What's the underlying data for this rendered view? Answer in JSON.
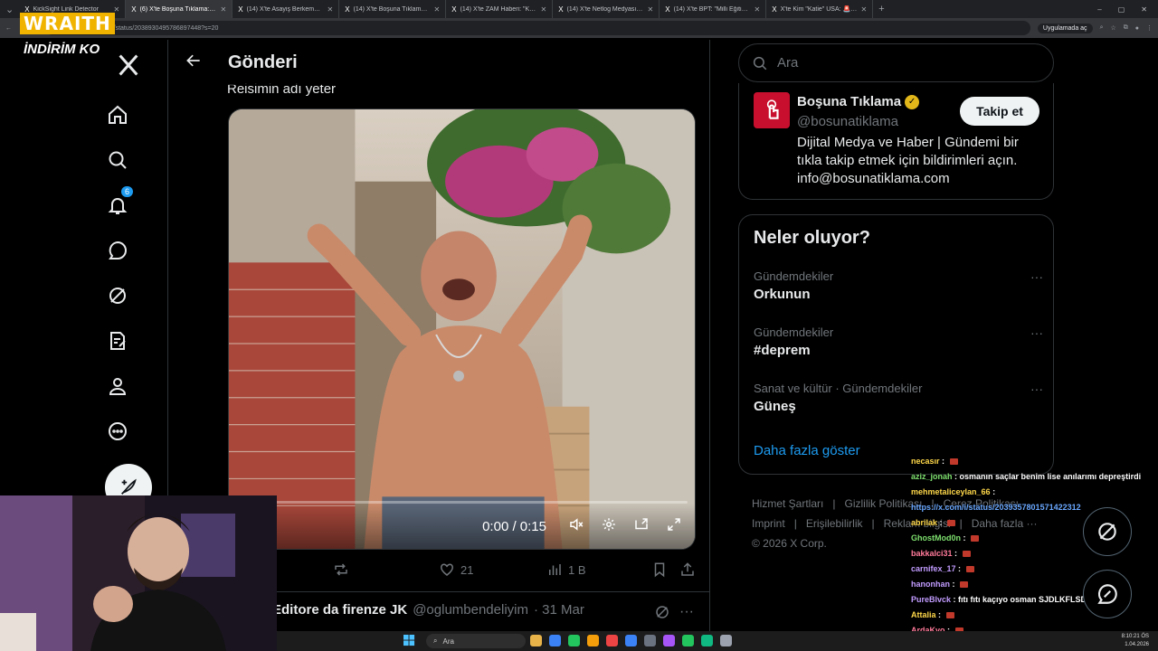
{
  "browser": {
    "tabs": [
      {
        "title": "KickSight Link Detector",
        "active": false
      },
      {
        "title": "(6) X'te Boşuna Tıklama: \"En...",
        "active": true
      },
      {
        "title": "(14) X'te Asayiş Berkemal: \"Esen...",
        "active": false
      },
      {
        "title": "(14) X'te Boşuna Tıklama: \"Hasa...",
        "active": false
      },
      {
        "title": "(14) X'te ZAM Haberi: \"KÜFÜRLÜ...",
        "active": false
      },
      {
        "title": "(14) X'te Netlog Medyası: \"Sipari...",
        "active": false
      },
      {
        "title": "(14) X'te BPT: \"Milli Eğitim Baka...",
        "active": false
      },
      {
        "title": "X'te Kim \"Katie\" USA: 🚨 BREA...",
        "active": false
      }
    ],
    "url": "x.com/bosunatiklama/status/2038930495786897448?s=20",
    "install_label": "Uygulamada aç"
  },
  "overlay": {
    "brand": "WRAITH",
    "subbrand": "İNDİRİM KO"
  },
  "nav": {
    "notifications_badge": "6"
  },
  "main": {
    "title": "Gönderi",
    "caption": "Reisimin adı yeter",
    "video_time": "0:00 / 0:15",
    "progress_fraction": 0,
    "likes": "21",
    "views": "1 B",
    "reply": {
      "name": "Editore da firenze JK",
      "handle": "@oglumbendeliyim",
      "date": "· 31 Mar"
    }
  },
  "right": {
    "search_placeholder": "Ara",
    "profile": {
      "name": "Boşuna Tıklama",
      "handle": "@bosunatiklama",
      "follow_label": "Takip et",
      "bio": "Dijital Medya ve Haber | Gündemi bir tıkla takip etmek için bildirimleri açın. info@bosunatiklama.com"
    },
    "trends_title": "Neler oluyor?",
    "trends": [
      {
        "context": "Gündemdekiler",
        "name": "Orkunun"
      },
      {
        "context": "Gündemdekiler",
        "name": "#deprem"
      },
      {
        "context": "Sanat ve kültür · Gündemdekiler",
        "name": "Güneş"
      }
    ],
    "show_more": "Daha fazla göster",
    "footer": {
      "links1": [
        "Hizmet Şartları",
        "|",
        "Gizlilik Politikası",
        "|",
        "Çerez Politikası"
      ],
      "links2": [
        "Imprint",
        "|",
        "Erişilebilirlik",
        "|",
        "Reklam bilgisi",
        "|",
        "Daha fazla ···"
      ],
      "copyright": "© 2026 X Corp."
    }
  },
  "chat": [
    {
      "user": "necasır",
      "msg": "",
      "color": "y",
      "emote": true
    },
    {
      "user": "aziz_jonah",
      "msg": "osmanın saçlar benim lise anılarımı depreştirdi",
      "color": "g",
      "emote": false
    },
    {
      "user": "mehmetaliceylan_66",
      "msg": "",
      "color": "y",
      "emote": false
    },
    {
      "user": "",
      "msg": "https://x.com/i/status/2039357801571422312",
      "color": "link",
      "emote": false
    },
    {
      "user": "abrilak",
      "msg": "",
      "color": "y",
      "emote": true
    },
    {
      "user": "GhostMod0n",
      "msg": "",
      "color": "g",
      "emote": true
    },
    {
      "user": "bakkalci31",
      "msg": "",
      "color": "p",
      "emote": true
    },
    {
      "user": "carnifex_17",
      "msg": "",
      "color": "v",
      "emote": true
    },
    {
      "user": "hanonhan",
      "msg": "",
      "color": "v",
      "emote": true
    },
    {
      "user": "PureBlvck",
      "msg": "fıtı fıtı kaçıyo osman SJDLKFLSDNFDS",
      "color": "v",
      "emote": false
    },
    {
      "user": "Attalia",
      "msg": "",
      "color": "y",
      "emote": true
    },
    {
      "user": "ArdaKvo",
      "msg": "",
      "color": "p",
      "emote": true
    }
  ],
  "taskbar": {
    "search": "Ara",
    "time": "8:10:21 ÖS",
    "date": "1.04.2026"
  },
  "colors": {
    "accent": "#1d9bf0",
    "border": "#2f3336",
    "muted": "#71767b",
    "brand_red": "#c8102e"
  }
}
